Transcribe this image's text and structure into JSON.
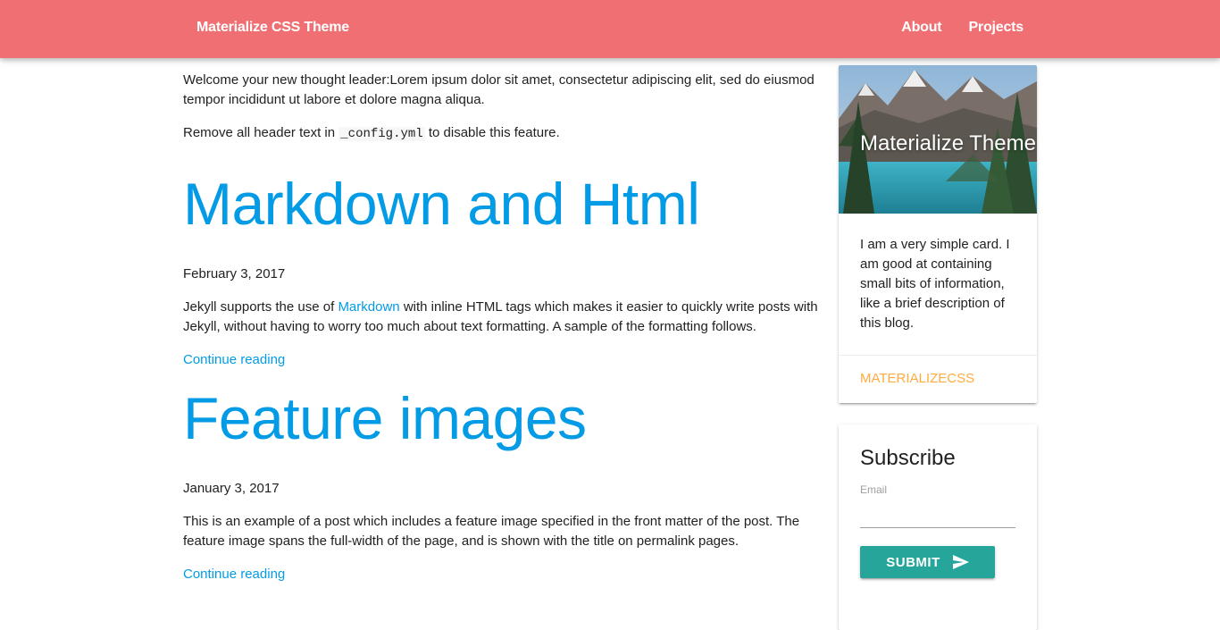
{
  "navbar": {
    "brand": "Materialize CSS Theme",
    "links": [
      "About",
      "Projects"
    ],
    "background_color": "#ef6f72"
  },
  "intro": {
    "text": "Welcome your new thought leader:Lorem ipsum dolor sit amet, consectetur adipiscing elit, sed do eiusmod tempor incididunt ut labore et dolore magna aliqua.",
    "config_prefix": "Remove all header text in",
    "config_code": "_config.yml",
    "config_suffix": "to disable this feature."
  },
  "posts": [
    {
      "title": "Markdown and Html",
      "date": "February 3, 2017",
      "excerpt_before": "Jekyll supports the use of",
      "excerpt_link": "Markdown",
      "excerpt_after": "with inline HTML tags which makes it easier to quickly write posts with Jekyll, without having to worry too much about text formatting. A sample of the formatting follows.",
      "read_more": "Continue reading"
    },
    {
      "title": "Feature images",
      "date": "January 3, 2017",
      "excerpt": "This is an example of a post which includes a feature image specified in the front matter of the post. The feature image spans the full-width of the page, and is shown with the title on permalink pages.",
      "read_more": "Continue reading"
    }
  ],
  "sidebar": {
    "card": {
      "title": "Materialize Theme",
      "content": "I am a very simple card. I am good at containing small bits of information, like a brief description of this blog.",
      "action": "MATERIALIZECSS",
      "image_icon": "mountain-lake-image"
    },
    "subscribe": {
      "title": "Subscribe",
      "email_label": "Email",
      "email_value": "",
      "email_placeholder": "",
      "submit_label": "SUBMIT",
      "submit_icon": "send-icon"
    }
  },
  "colors": {
    "link": "#039be5",
    "accent": "#ffab40",
    "button": "#26a69a"
  }
}
